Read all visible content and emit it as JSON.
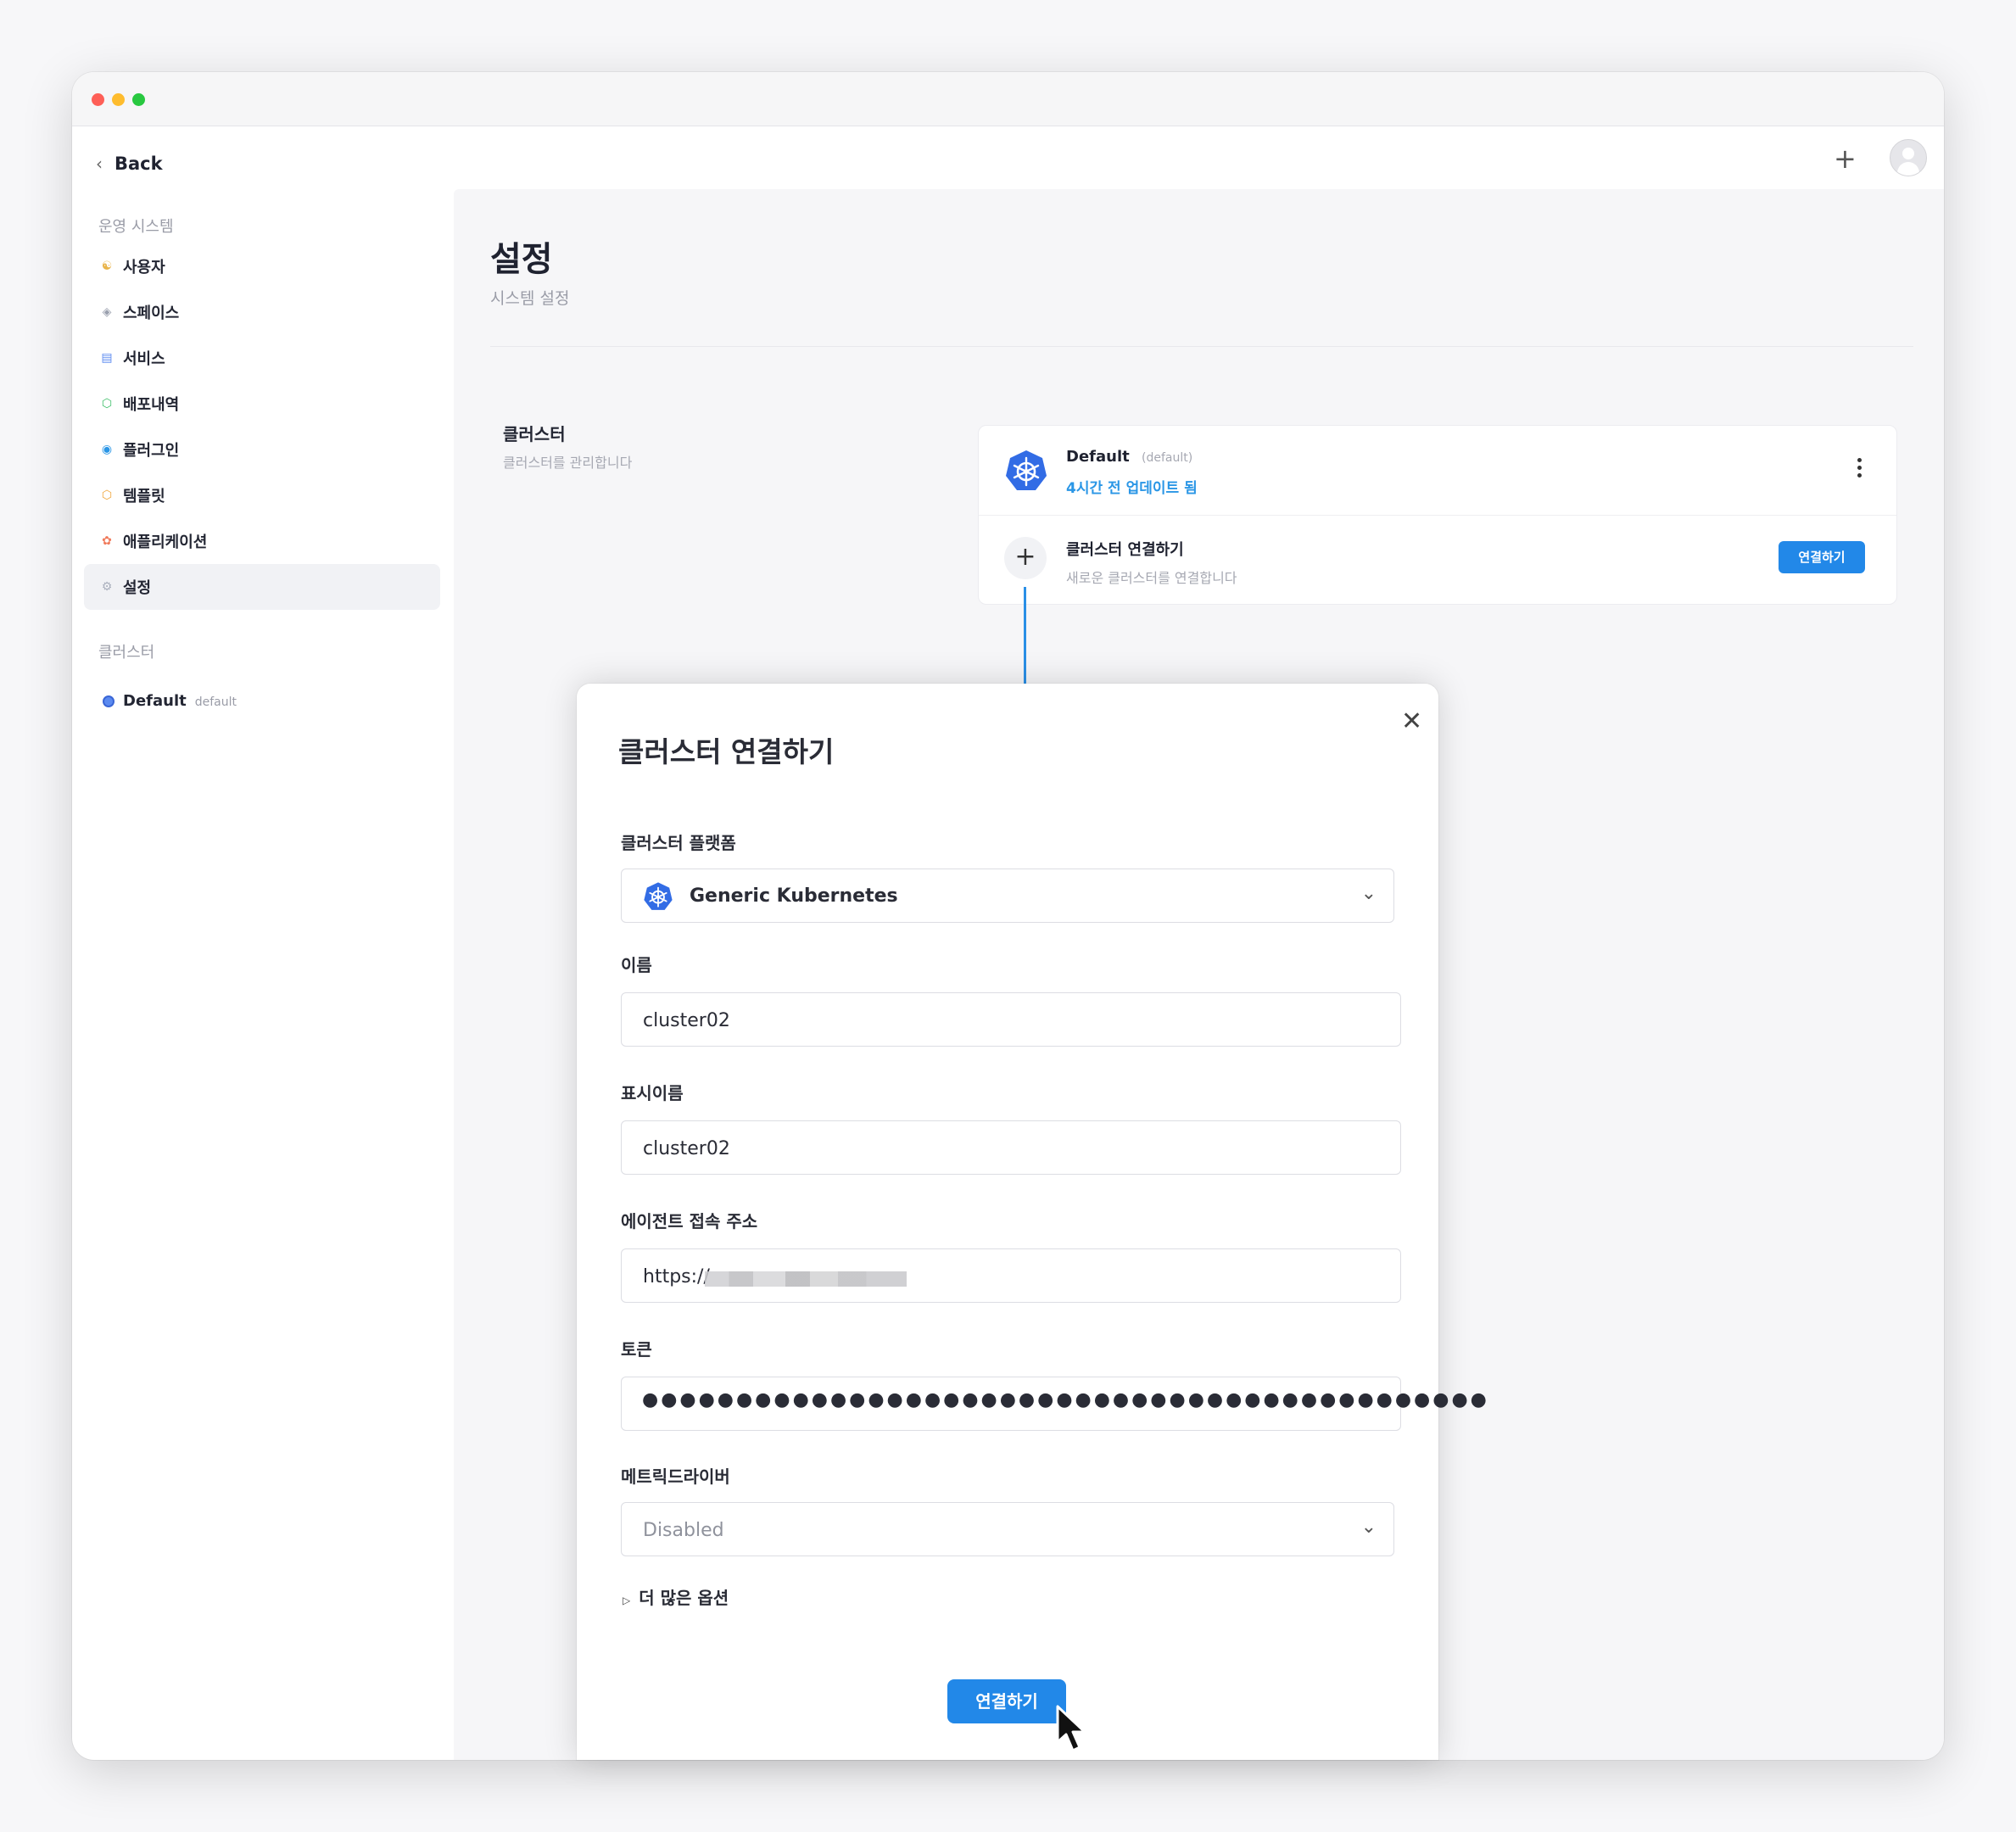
{
  "header": {
    "back_label": "Back"
  },
  "sidebar": {
    "section_ops": "운영 시스템",
    "items": [
      {
        "label": "사용자",
        "icon": "users-icon"
      },
      {
        "label": "스페이스",
        "icon": "layers-icon"
      },
      {
        "label": "서비스",
        "icon": "window-icon"
      },
      {
        "label": "배포내역",
        "icon": "box-icon"
      },
      {
        "label": "플러그인",
        "icon": "plugin-icon"
      },
      {
        "label": "템플릿",
        "icon": "template-icon"
      },
      {
        "label": "애플리케이션",
        "icon": "app-icon"
      },
      {
        "label": "설정",
        "icon": "gear-icon"
      }
    ],
    "active_item": "설정",
    "section_cluster": "클러스터",
    "cluster": {
      "name": "Default",
      "tag": "default"
    }
  },
  "page": {
    "title": "설정",
    "subtitle": "시스템 설정",
    "section_name": "클러스터",
    "section_desc": "클러스터를 관리합니다"
  },
  "cluster_card": {
    "default_name": "Default",
    "default_tag": "(default)",
    "default_updated": "4시간 전 업데이트 됨",
    "connect_title": "클러스터 연결하기",
    "connect_desc": "새로운 클러스터를 연결합니다",
    "connect_button": "연결하기"
  },
  "modal": {
    "title": "클러스터 연결하기",
    "platform_label": "클러스터 플랫폼",
    "platform_value": "Generic Kubernetes",
    "name_label": "이름",
    "name_value": "cluster02",
    "display_label": "표시이름",
    "display_value": "cluster02",
    "agent_label": "에이전트 접속 주소",
    "agent_value": "https://",
    "token_label": "토큰",
    "token_value": "●●●●●●●●●●●●●●●●●●●●●●●●●●●●●●●●●●●●●●●●●●●●●",
    "metric_label": "메트릭드라이버",
    "metric_value": "Disabled",
    "more_options": "더 많은 옵션",
    "submit": "연결하기"
  },
  "colors": {
    "accent": "#2288e8",
    "kubernetes_blue": "#326ce5",
    "link_blue": "#2a96e6"
  }
}
